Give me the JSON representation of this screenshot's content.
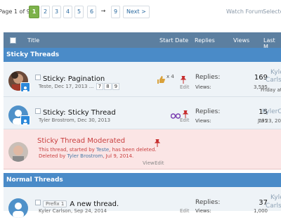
{
  "pagination": {
    "label": "Page 1 of 9",
    "pages": [
      "1",
      "2",
      "3",
      "4",
      "5",
      "6"
    ],
    "arrow": "→",
    "last_page": "9",
    "next_label": "Next >"
  },
  "toolbar": {
    "watch_forum": "Watch Forum",
    "selected": "Selecte"
  },
  "columns": {
    "title": "Title",
    "start_date": "Start Date",
    "replies": "Replies",
    "views": "Views",
    "last": "Last M"
  },
  "sections": {
    "sticky": "Sticky Threads",
    "normal": "Normal Threads"
  },
  "threads": [
    {
      "title": "Sticky: Pagination",
      "author": "Teste",
      "date": "Dec 17, 2013",
      "ellipsis": "...",
      "mini_pages": [
        "7",
        "8",
        "9"
      ],
      "like_count": "x 4",
      "edit": "Edit",
      "replies_label": "Replies:",
      "replies": "169",
      "views_label": "Views:",
      "views": "3,595",
      "last_user": "Kyle",
      "last_user2": "Carlso",
      "last_date": "Friday at 1"
    },
    {
      "title": "Sticky: Sticky Thread",
      "author": "Tyler Brostrom",
      "date": "Dec 30, 2013",
      "edit": "Edit",
      "replies_label": "Replies:",
      "replies": "15",
      "views_label": "Views:",
      "views": "795",
      "last_user": "KylerC",
      "last_date": "Jul 23, 201"
    },
    {
      "title": "Sticky Thread Moderated",
      "deleted_prefix": "This thread, started by",
      "deleted_author": "Teste",
      "deleted_suffix": ", has been deleted.",
      "deleted_by_prefix": "Deleted by",
      "deleted_by": "Tyler Brostrom",
      "deleted_date": ", Jul 9, 2014.",
      "view": "View",
      "edit": "Edit"
    },
    {
      "prefix": "Prefix 1",
      "title": "A new thread.",
      "author": "Kyler Carlson",
      "date": "Sep 24, 2014",
      "edit": "Edit",
      "replies_label": "Replies:",
      "replies": "37",
      "views_label": "Views:",
      "views": "1,000",
      "last_user": "Kyle",
      "last_user2": "Carlso"
    }
  ],
  "colors": {
    "header": "#5c7fa0",
    "section": "#4a8bc8",
    "current_page": "#7db24a",
    "deleted_bg": "#fbe5e5",
    "deleted_text": "#c94040"
  }
}
